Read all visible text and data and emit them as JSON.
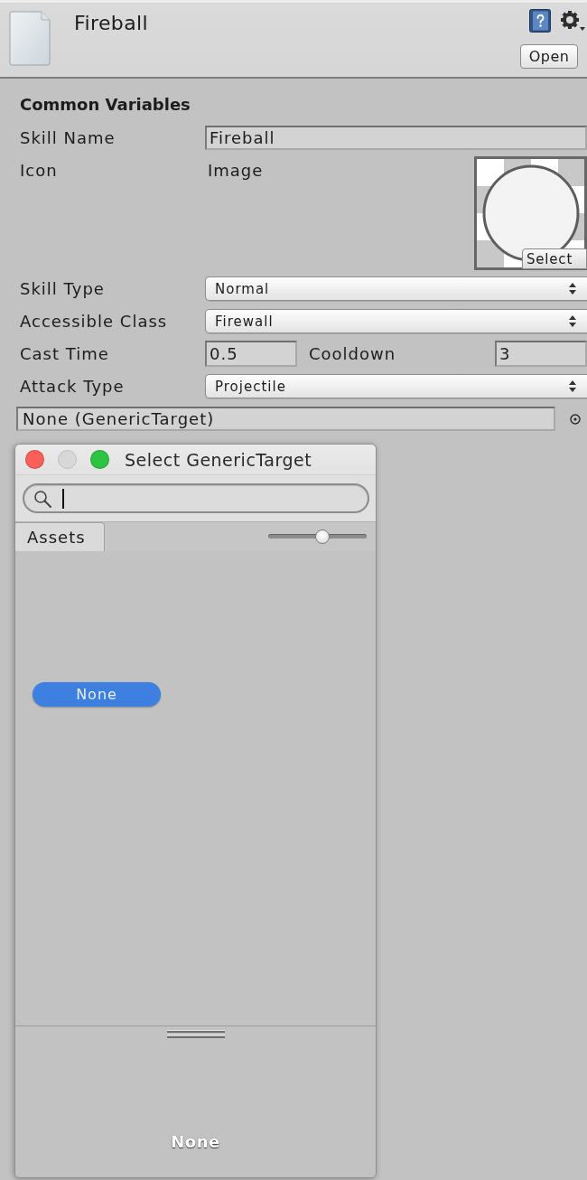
{
  "header": {
    "title": "Fireball",
    "button": "Open"
  },
  "section": {
    "title": "Common Variables",
    "fields": [
      {
        "kind": "text",
        "label": "Skill Name",
        "value": "Fireball"
      },
      {
        "kind": "image",
        "label": "Icon",
        "caption": "Image",
        "button": "Select"
      },
      {
        "kind": "dropdown",
        "label": "Skill Type",
        "value": "Normal"
      },
      {
        "kind": "dropdown",
        "label": "Accessible Class",
        "value": "Firewall"
      },
      {
        "kind": "pair",
        "parts": [
          {
            "label": "Cast Time",
            "value": "0.5"
          },
          {
            "label": "Cooldown",
            "value": "3"
          }
        ]
      },
      {
        "kind": "dropdown",
        "label": "Attack Type",
        "value": "Projectile"
      },
      {
        "kind": "object",
        "value": "None (GenericTarget)"
      }
    ]
  },
  "picker": {
    "title": "Select GenericTarget",
    "window_buttons": [
      {
        "kind": "close",
        "disabled": false
      },
      {
        "kind": "minimize",
        "disabled": true
      },
      {
        "kind": "zoom",
        "disabled": false
      }
    ],
    "search": {
      "focused": true
    },
    "tabs": [
      {
        "label": "Assets",
        "selected": true
      }
    ],
    "slider": {
      "level": 0.56
    },
    "items": [
      {
        "label": "None",
        "selected": true
      }
    ],
    "preview": {
      "label": "None"
    }
  }
}
